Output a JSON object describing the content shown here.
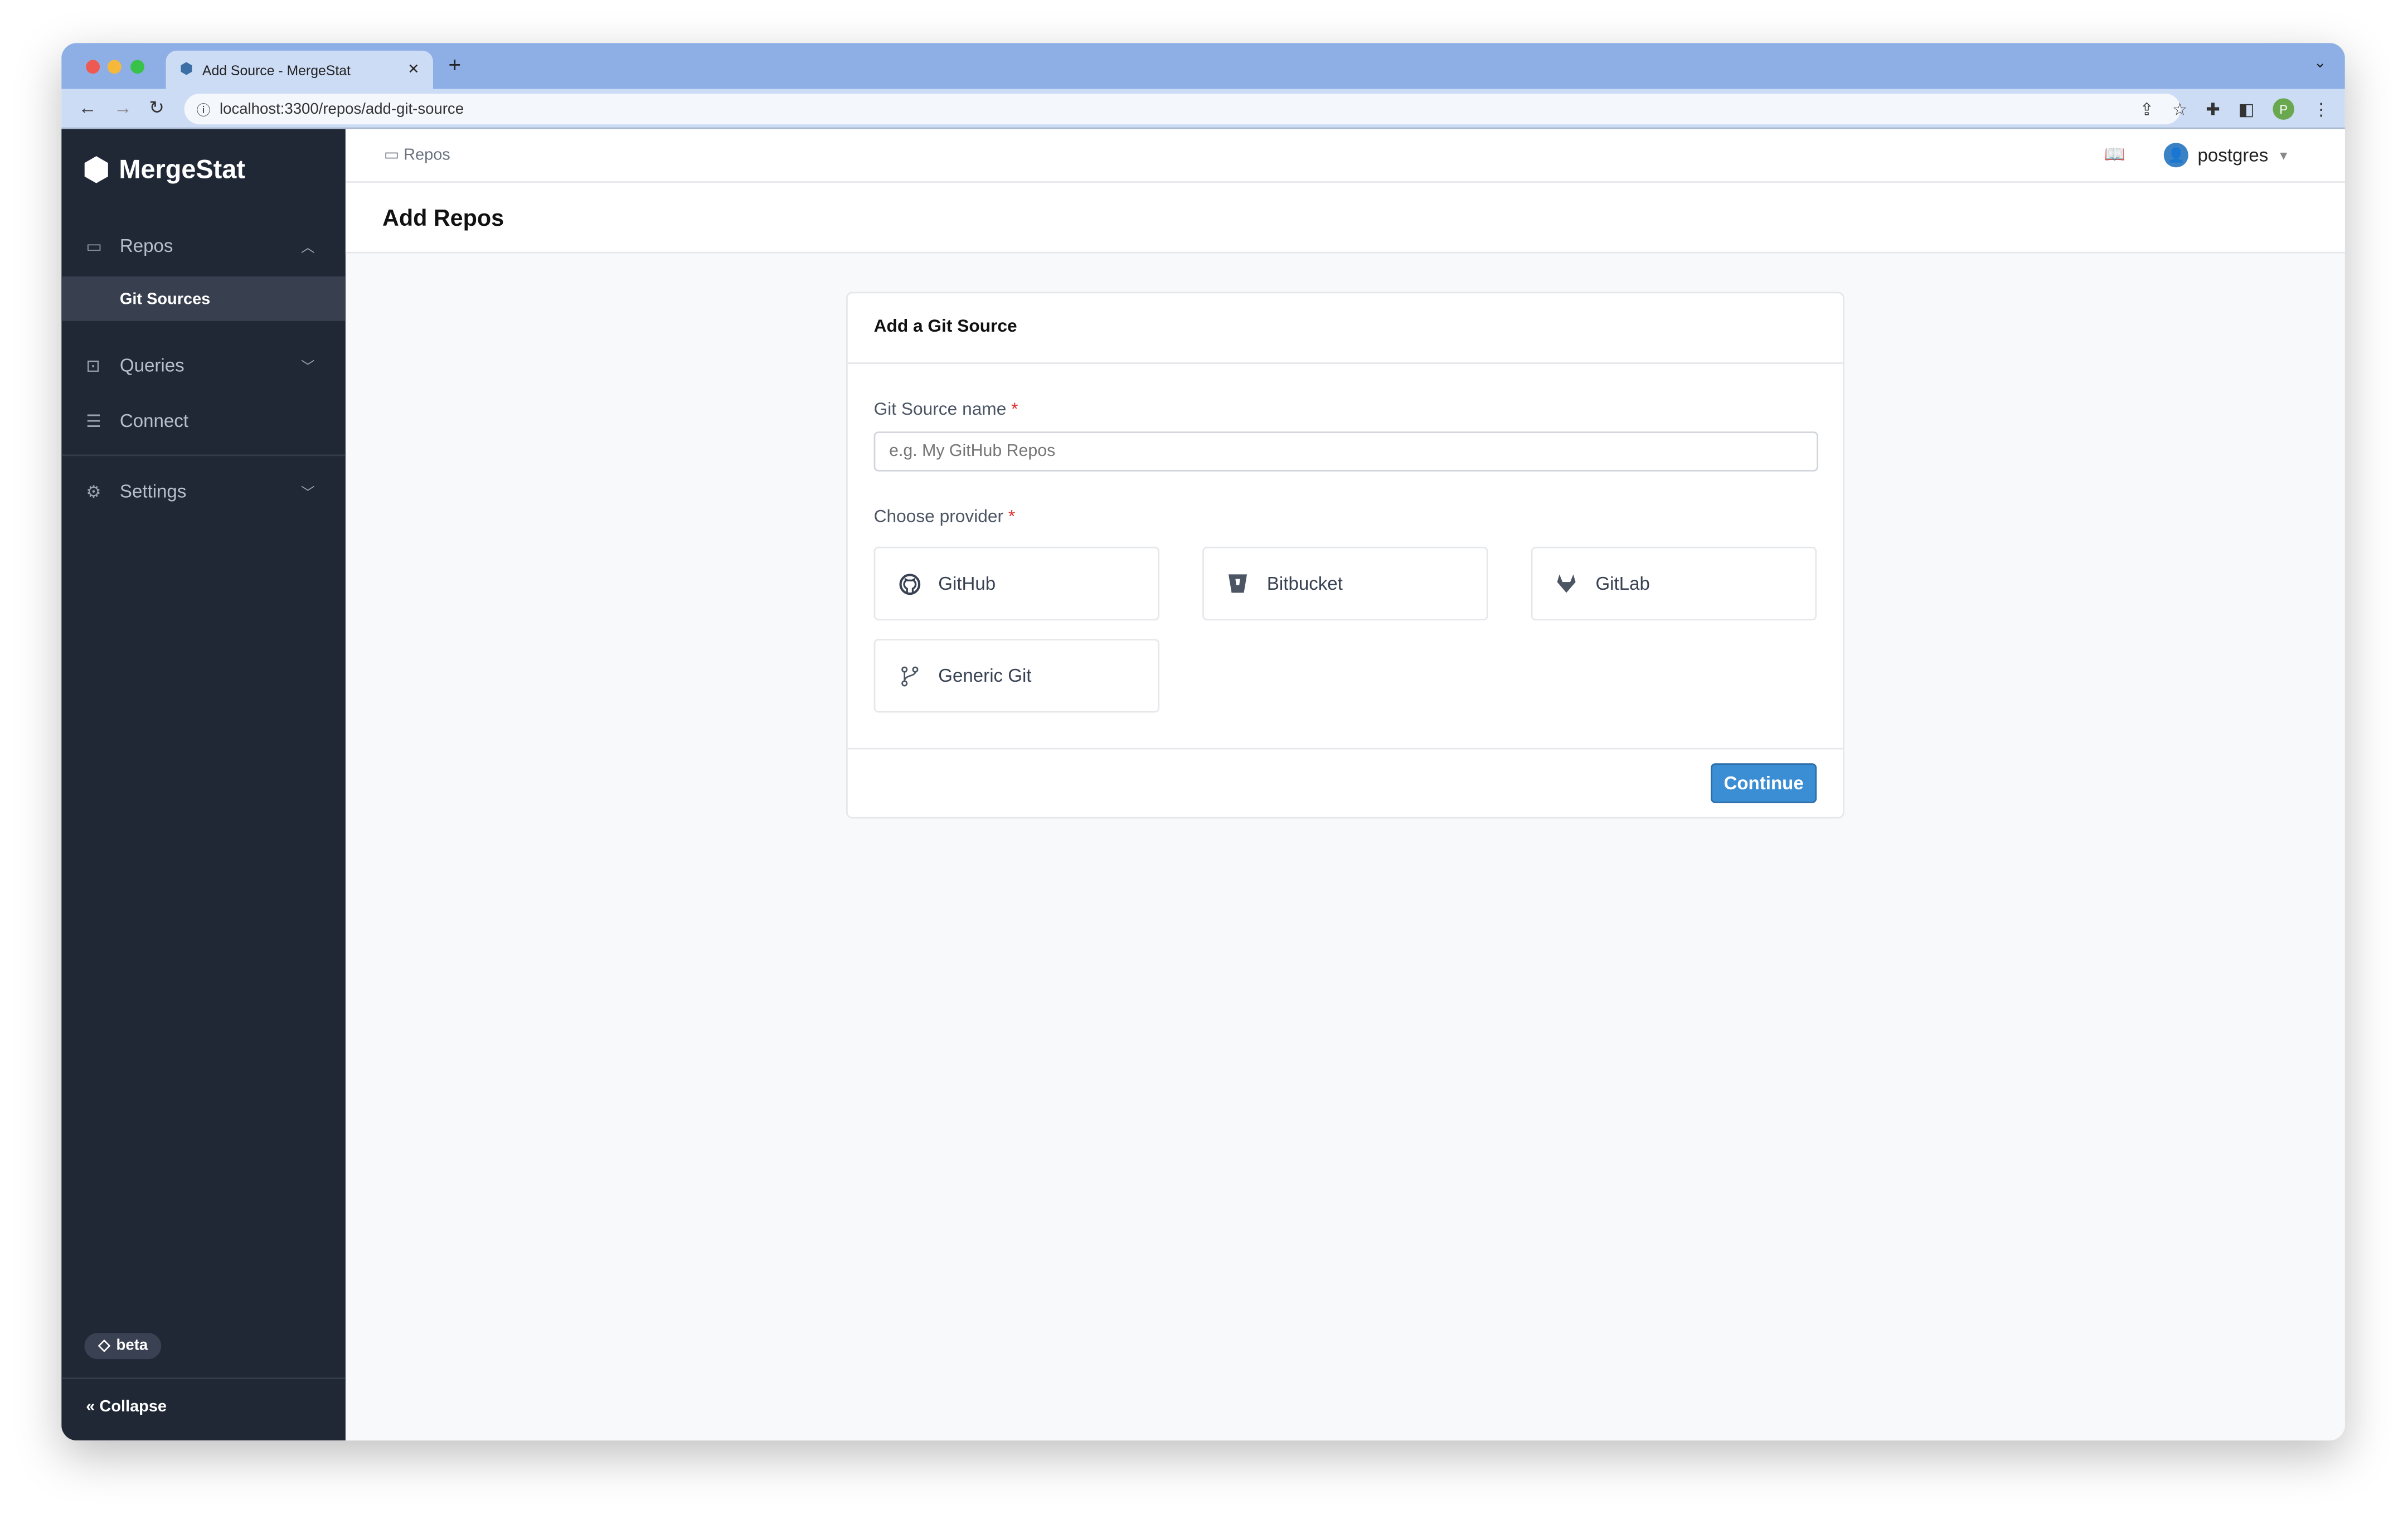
{
  "browser": {
    "tab_title": "Add Source - MergeStat",
    "url": "localhost:3300/repos/add-git-source",
    "profile_initial": "P"
  },
  "sidebar": {
    "brand": "MergeStat",
    "items": [
      {
        "label": "Repos",
        "icon": "repo-icon"
      },
      {
        "label": "Queries",
        "icon": "terminal-icon"
      },
      {
        "label": "Connect",
        "icon": "database-icon"
      },
      {
        "label": "Settings",
        "icon": "gear-icon"
      }
    ],
    "sub_item": "Git Sources",
    "beta": "beta",
    "collapse": "Collapse"
  },
  "header": {
    "breadcrumb": "Repos",
    "user": "postgres",
    "title": "Add Repos"
  },
  "card": {
    "title": "Add a Git Source",
    "name_label": "Git Source name",
    "required_mark": "*",
    "name_placeholder": "e.g. My GitHub Repos",
    "name_value": "",
    "provider_label": "Choose provider",
    "providers": [
      {
        "label": "GitHub",
        "icon": "github-icon"
      },
      {
        "label": "Bitbucket",
        "icon": "bitbucket-icon"
      },
      {
        "label": "GitLab",
        "icon": "gitlab-icon"
      },
      {
        "label": "Generic Git",
        "icon": "git-branch-icon"
      }
    ],
    "continue": "Continue"
  },
  "colors": {
    "sidebar": "#202836",
    "accent": "#3b8ed4",
    "required": "#dd3333"
  }
}
